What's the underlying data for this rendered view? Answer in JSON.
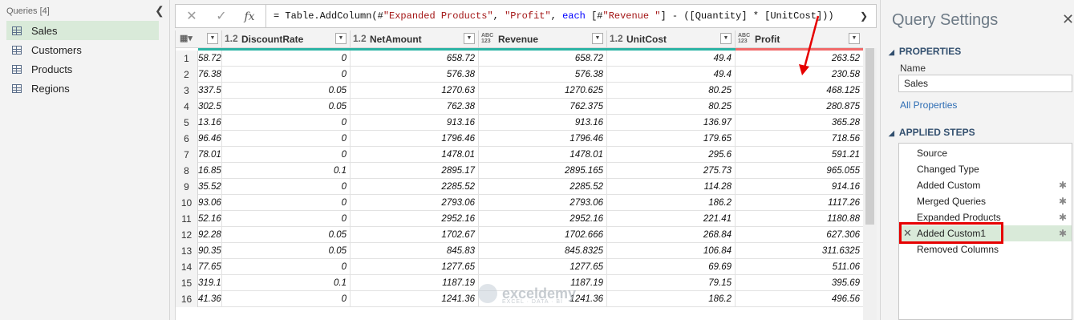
{
  "queries": {
    "header": "Queries [4]",
    "collapse_icon": "chevron-left-icon",
    "items": [
      {
        "label": "Sales",
        "active": true
      },
      {
        "label": "Customers",
        "active": false
      },
      {
        "label": "Products",
        "active": false
      },
      {
        "label": "Regions",
        "active": false
      }
    ]
  },
  "formula_bar": {
    "cancel_icon": "close-icon",
    "commit_icon": "check-icon",
    "fx_label": "fx",
    "formula": "= Table.AddColumn(#\"Expanded Products\", \"Profit\", each [#\"Revenue \"] - ([Quantity] * [UnitCost]))",
    "formula_parts": [
      {
        "t": "= Table.AddColumn(#",
        "c": ""
      },
      {
        "t": "\"Expanded Products\"",
        "c": "s"
      },
      {
        "t": ", ",
        "c": ""
      },
      {
        "t": "\"Profit\"",
        "c": "s"
      },
      {
        "t": ", ",
        "c": ""
      },
      {
        "t": "each",
        "c": "k"
      },
      {
        "t": " [#",
        "c": ""
      },
      {
        "t": "\"Revenue \"",
        "c": "s"
      },
      {
        "t": "] - ([Quantity] * [UnitCost]))",
        "c": ""
      }
    ]
  },
  "grid": {
    "columns": [
      {
        "type": "",
        "name": "",
        "partial": true
      },
      {
        "type": "1.2",
        "name": "DiscountRate"
      },
      {
        "type": "1.2",
        "name": "NetAmount"
      },
      {
        "type": "ABC\n123",
        "name": "Revenue"
      },
      {
        "type": "1.2",
        "name": "UnitCost"
      },
      {
        "type": "ABC\n123",
        "name": "Profit"
      }
    ],
    "rows": [
      {
        "n": "1",
        "c": [
          "58.72",
          "0",
          "658.72",
          "658.72",
          "49.4",
          "263.52"
        ]
      },
      {
        "n": "2",
        "c": [
          "76.38",
          "0",
          "576.38",
          "576.38",
          "49.4",
          "230.58"
        ]
      },
      {
        "n": "3",
        "c": [
          "337.5",
          "0.05",
          "1270.63",
          "1270.625",
          "80.25",
          "468.125"
        ]
      },
      {
        "n": "4",
        "c": [
          "302.5",
          "0.05",
          "762.38",
          "762.375",
          "80.25",
          "280.875"
        ]
      },
      {
        "n": "5",
        "c": [
          "13.16",
          "0",
          "913.16",
          "913.16",
          "136.97",
          "365.28"
        ]
      },
      {
        "n": "6",
        "c": [
          "96.46",
          "0",
          "1796.46",
          "1796.46",
          "179.65",
          "718.56"
        ]
      },
      {
        "n": "7",
        "c": [
          "78.01",
          "0",
          "1478.01",
          "1478.01",
          "295.6",
          "591.21"
        ]
      },
      {
        "n": "8",
        "c": [
          "16.85",
          "0.1",
          "2895.17",
          "2895.165",
          "275.73",
          "965.055"
        ]
      },
      {
        "n": "9",
        "c": [
          "35.52",
          "0",
          "2285.52",
          "2285.52",
          "114.28",
          "914.16"
        ]
      },
      {
        "n": "10",
        "c": [
          "93.06",
          "0",
          "2793.06",
          "2793.06",
          "186.2",
          "1117.26"
        ]
      },
      {
        "n": "11",
        "c": [
          "52.16",
          "0",
          "2952.16",
          "2952.16",
          "221.41",
          "1180.88"
        ]
      },
      {
        "n": "12",
        "c": [
          "92.28",
          "0.05",
          "1702.67",
          "1702.666",
          "268.84",
          "627.306"
        ]
      },
      {
        "n": "13",
        "c": [
          "90.35",
          "0.05",
          "845.83",
          "845.8325",
          "106.84",
          "311.6325"
        ]
      },
      {
        "n": "14",
        "c": [
          "77.65",
          "0",
          "1277.65",
          "1277.65",
          "69.69",
          "511.06"
        ]
      },
      {
        "n": "15",
        "c": [
          "319.1",
          "0.1",
          "1187.19",
          "1187.19",
          "79.15",
          "395.69"
        ]
      },
      {
        "n": "16",
        "c": [
          "41.36",
          "0",
          "1241.36",
          "1241.36",
          "186.2",
          "496.56"
        ]
      }
    ]
  },
  "watermark": {
    "name": "exceldemy",
    "tagline": "EXCEL · DATA · BI"
  },
  "settings": {
    "title": "Query Settings",
    "close_icon": "close-icon",
    "properties_heading": "PROPERTIES",
    "name_label": "Name",
    "name_value": "Sales",
    "all_properties": "All Properties",
    "steps_heading": "APPLIED STEPS",
    "steps": [
      {
        "label": "Source",
        "gear": false,
        "active": false
      },
      {
        "label": "Changed Type",
        "gear": false,
        "active": false
      },
      {
        "label": "Added Custom",
        "gear": true,
        "active": false
      },
      {
        "label": "Merged Queries",
        "gear": true,
        "active": false
      },
      {
        "label": "Expanded Products",
        "gear": true,
        "active": false
      },
      {
        "label": "Added Custom1",
        "gear": true,
        "active": true
      },
      {
        "label": "Removed Columns",
        "gear": false,
        "active": false
      }
    ]
  },
  "colors": {
    "quality_bar": "#2bb3a4",
    "error_bar": "#f06a6a",
    "highlight": "#e60000",
    "active_row": "#d9ead9"
  }
}
